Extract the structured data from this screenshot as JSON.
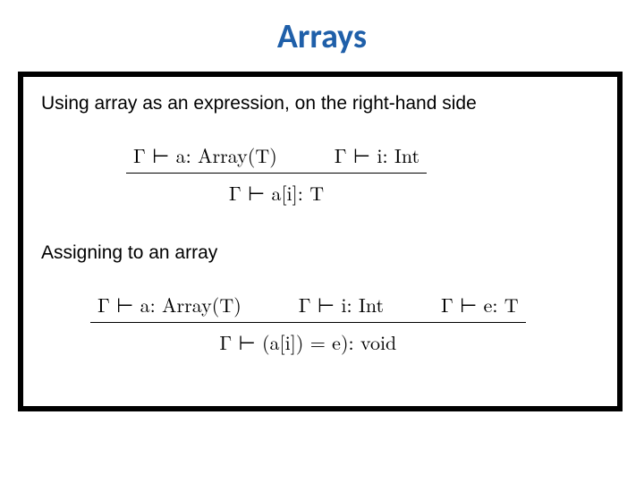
{
  "title": "Arrays",
  "section1": {
    "heading": "Using array as an expression, on the right-hand side",
    "rule": {
      "premise_a": "Γ ⊢ a: Array(T)",
      "premise_b": "Γ ⊢ i: Int",
      "conclusion": "Γ ⊢ a[i]: T"
    }
  },
  "section2": {
    "heading": "Assigning to an array",
    "rule": {
      "premise_a": "Γ ⊢ a: Array(T)",
      "premise_b": "Γ ⊢ i: Int",
      "premise_c": "Γ ⊢ e: T",
      "conclusion": "Γ ⊢ (a[i]) = e): void"
    }
  }
}
